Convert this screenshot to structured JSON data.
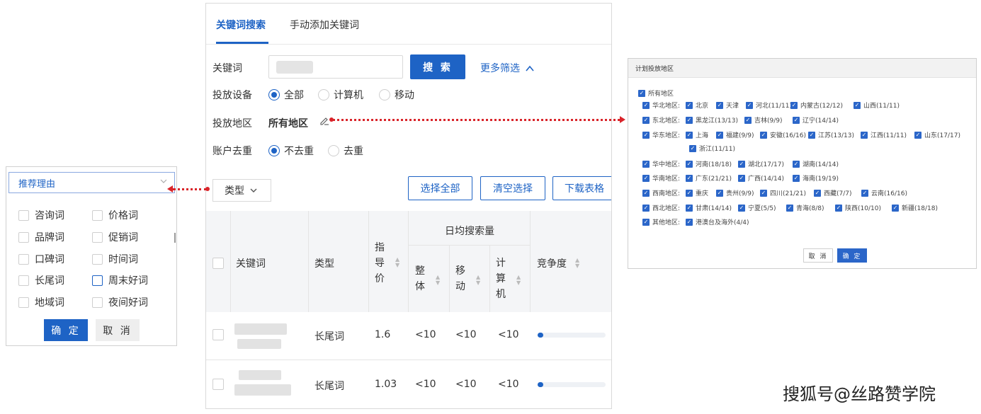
{
  "main": {
    "tabs": [
      "关键词搜索",
      "手动添加关键词"
    ],
    "form": {
      "keyword_label": "关键词",
      "search_button": "搜 索",
      "more_filters": "更多筛选",
      "device_label": "投放设备",
      "device_options": [
        "全部",
        "计算机",
        "移动"
      ],
      "device_selected": "全部",
      "region_label": "投放地区",
      "region_value": "所有地区",
      "dedupe_label": "账户去重",
      "dedupe_options": [
        "不去重",
        "去重"
      ],
      "dedupe_selected": "不去重"
    },
    "toolbar": {
      "type_select": "类型",
      "select_all": "选择全部",
      "clear_selection": "清空选择",
      "download_table": "下载表格"
    },
    "table": {
      "headers": {
        "keyword": "关键词",
        "type": "类型",
        "guide_price": "指导价",
        "daily_search": "日均搜索量",
        "overall": "整体",
        "mobile": "移动",
        "computer": "计算机",
        "competition": "竞争度"
      },
      "rows": [
        {
          "type": "长尾词",
          "price": "1.6",
          "overall": "<10",
          "mobile": "<10",
          "computer": "<10",
          "competition": 0.05
        },
        {
          "type": "长尾词",
          "price": "1.03",
          "overall": "<10",
          "mobile": "<10",
          "computer": "<10",
          "competition": 0.05
        }
      ]
    }
  },
  "reason_panel": {
    "select_label": "推荐理由",
    "options": [
      {
        "label": "咨询词",
        "checked": false
      },
      {
        "label": "价格词",
        "checked": false
      },
      {
        "label": "品牌词",
        "checked": false
      },
      {
        "label": "促销词",
        "checked": false
      },
      {
        "label": "口碑词",
        "checked": false
      },
      {
        "label": "时间词",
        "checked": false
      },
      {
        "label": "长尾词",
        "checked": false
      },
      {
        "label": "周末好词",
        "checked": false
      },
      {
        "label": "地域词",
        "checked": false
      },
      {
        "label": "夜间好词",
        "checked": false
      }
    ],
    "ok": "确 定",
    "cancel": "取 消"
  },
  "region_panel": {
    "title": "计划投放地区",
    "all_label": "所有地区",
    "groups": [
      {
        "name": "华北地区:",
        "items": [
          "北京",
          "天津",
          "河北(11/11)",
          "内蒙古(12/12)",
          "山西(11/11)"
        ]
      },
      {
        "name": "东北地区:",
        "items": [
          "黑龙江(13/13)",
          "吉林(9/9)",
          "辽宁(14/14)"
        ]
      },
      {
        "name": "华东地区:",
        "items": [
          "上海",
          "福建(9/9)",
          "安徽(16/16)",
          "江苏(13/13)",
          "江西(11/11)",
          "山东(17/17)",
          "浙江(11/11)"
        ]
      },
      {
        "name": "华中地区:",
        "items": [
          "河南(18/18)",
          "湖北(17/17)",
          "湖南(14/14)"
        ]
      },
      {
        "name": "华南地区:",
        "items": [
          "广东(21/21)",
          "广西(14/14)",
          "海南(19/19)"
        ]
      },
      {
        "name": "西南地区:",
        "items": [
          "重庆",
          "贵州(9/9)",
          "四川(21/21)",
          "西藏(7/7)",
          "云南(16/16)"
        ]
      },
      {
        "name": "西北地区:",
        "items": [
          "甘肃(14/14)",
          "宁夏(5/5)",
          "青海(8/8)",
          "陕西(10/10)",
          "新疆(18/18)"
        ]
      },
      {
        "name": "其他地区:",
        "items": [
          "港澳台及海外(4/4)"
        ]
      }
    ],
    "cancel": "取 消",
    "ok": "确 定"
  },
  "watermark": "搜狐号@丝路赞学院",
  "colors": {
    "primary": "#1e63c5",
    "connector": "#d9242a"
  }
}
